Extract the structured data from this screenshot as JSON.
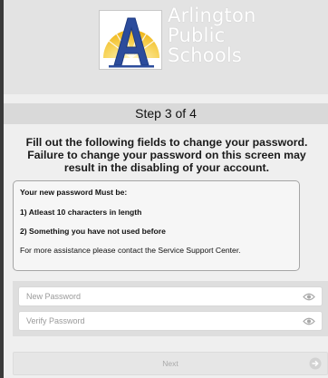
{
  "header": {
    "logo_lines": [
      "Arlington",
      "Public",
      "Schools"
    ]
  },
  "step": {
    "label": "Step 3 of 4"
  },
  "instructions": "Fill out the following fields to change your password. Failure to change your password on this screen may result in the disabling of your account.",
  "requirements": {
    "heading": "Your new password Must be:",
    "items": [
      "1) Atleast 10 characters in length",
      "2) Something you have not used before"
    ],
    "assistance": "For more assistance please contact the Service Support Center."
  },
  "form": {
    "new_password_placeholder": "New Password",
    "verify_password_placeholder": "Verify Password",
    "next_label": "Next"
  },
  "colors": {
    "logo_blue": "#2c4c9c",
    "logo_yellow": "#f2c12e",
    "step_bar": "#d9d9d9"
  },
  "icons": {
    "password_visibility": "eye-icon",
    "next": "arrow-right-circle-icon"
  }
}
